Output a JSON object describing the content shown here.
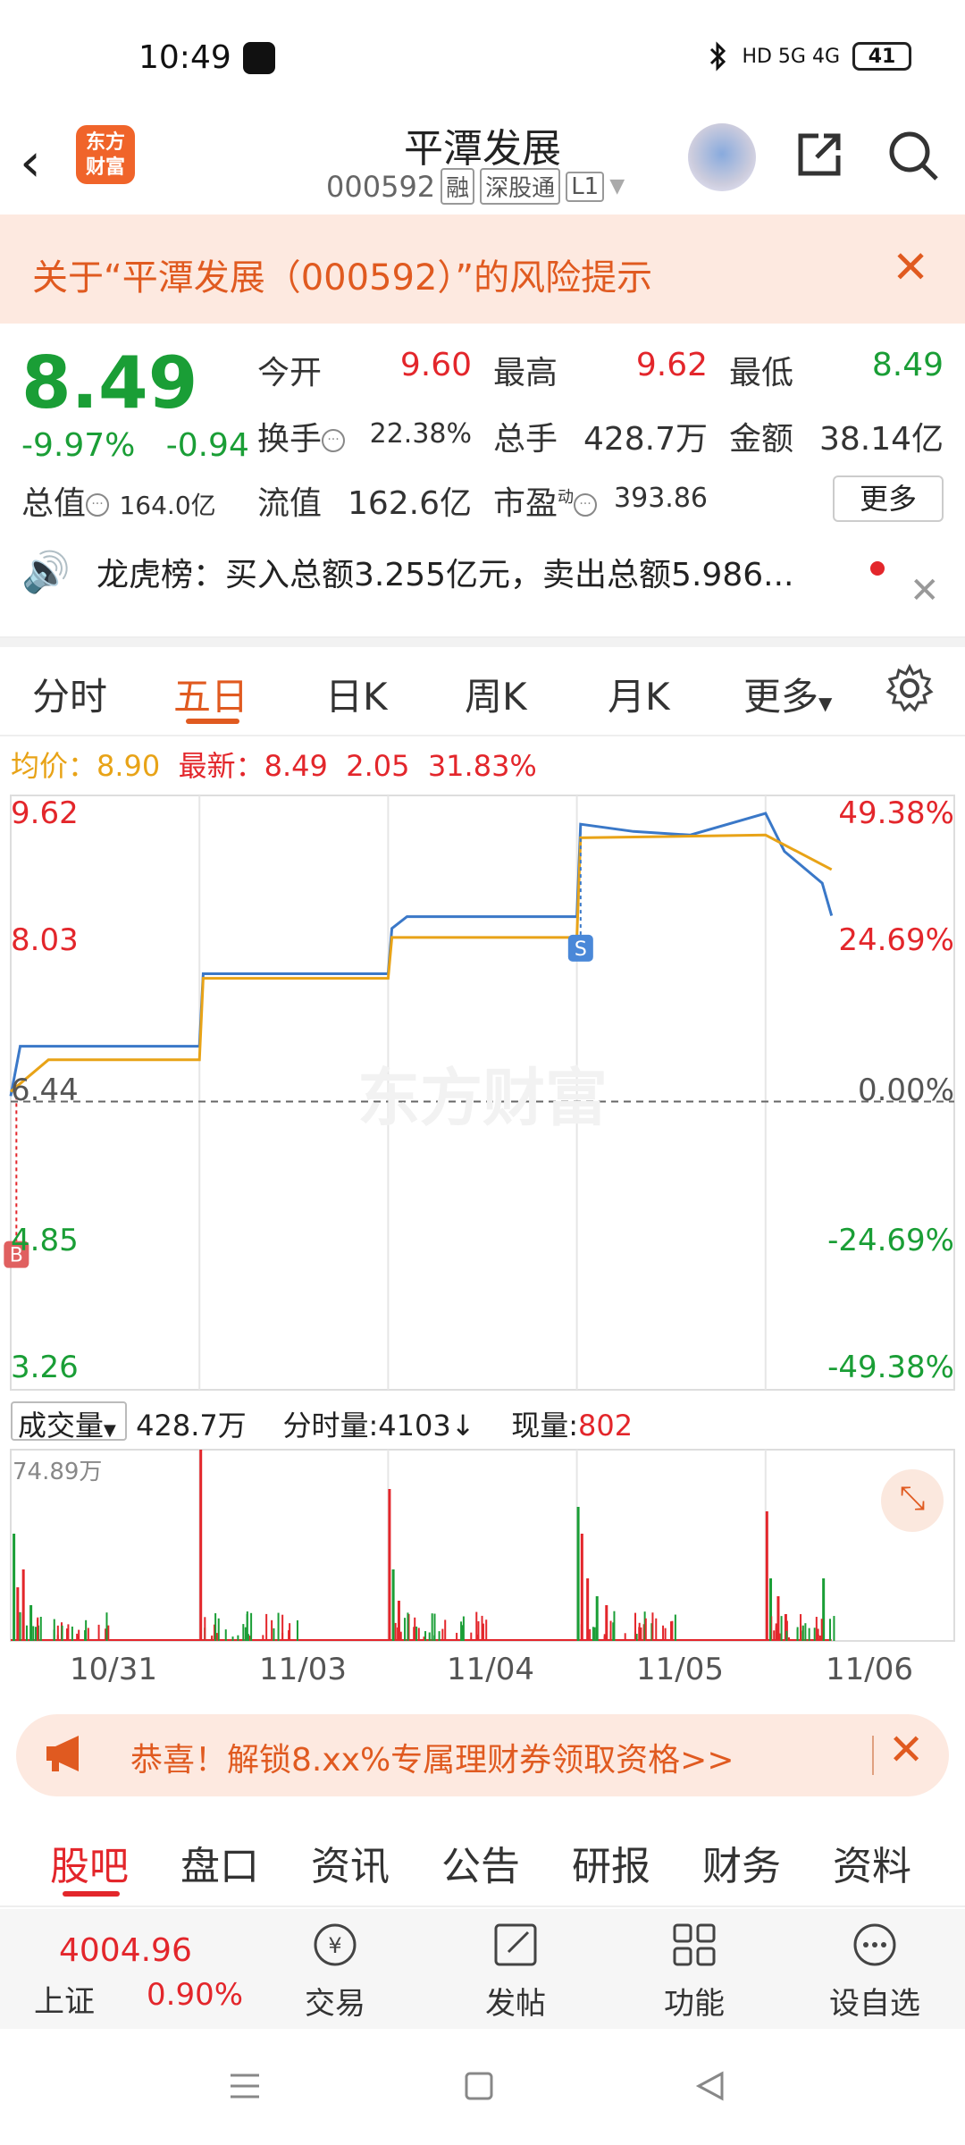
{
  "status_bar": {
    "time": "10:49",
    "network": "HD 5G 4G",
    "battery": "41"
  },
  "header": {
    "back": "‹",
    "logo_line1": "东方",
    "logo_line2": "财富",
    "stock_name": "平潭发展",
    "stock_code": "000592",
    "tag_margin": "融",
    "tag_connect": "深股通",
    "tag_level": "L1"
  },
  "risk_banner": {
    "text": "关于“平潭发展（000592）”的风险提示"
  },
  "quote": {
    "price": "8.49",
    "change_pct": "-9.97%",
    "change_amt": "-0.94",
    "open_label": "今开",
    "open": "9.60",
    "high_label": "最高",
    "high": "9.62",
    "low_label": "最低",
    "low": "8.49",
    "turnover_label": "换手",
    "turnover": "22.38%",
    "volume_label": "总手",
    "volume": "428.7万",
    "amount_label": "金额",
    "amount": "38.14亿",
    "mktcap_label": "总值",
    "mktcap": "164.0亿",
    "float_label": "流值",
    "float": "162.6亿",
    "pe_label": "市盈",
    "pe_sup": "动",
    "pe": "393.86",
    "more": "更多"
  },
  "dragon_tiger": {
    "text": "龙虎榜：买入总额3.255亿元，卖出总额5.986..."
  },
  "chart_tabs": [
    "分时",
    "五日",
    "日K",
    "周K",
    "月K",
    "更多"
  ],
  "avg_line": {
    "avg_label": "均价：",
    "avg": "8.90",
    "latest_label": "最新：",
    "latest": "8.49",
    "change": "2.05",
    "change_pct": "31.83%"
  },
  "chart_data": {
    "type": "line",
    "y_left_ticks": [
      "9.62",
      "8.03",
      "6.44",
      "4.85",
      "3.26"
    ],
    "y_right_ticks": [
      "49.38%",
      "24.69%",
      "0.00%",
      "-24.69%",
      "-49.38%"
    ],
    "x": [
      "10/31",
      "11/03",
      "11/04",
      "11/05",
      "11/06"
    ],
    "ylim": [
      3.26,
      9.62
    ],
    "series": [
      {
        "name": "price",
        "color": "#3a78c8",
        "values": [
          [
            0.0,
            6.5
          ],
          [
            0.05,
            7.05
          ],
          [
            0.2,
            7.05
          ],
          [
            1.0,
            7.05
          ],
          [
            1.02,
            7.85
          ],
          [
            2.0,
            7.85
          ],
          [
            2.02,
            8.35
          ],
          [
            2.1,
            8.48
          ],
          [
            3.0,
            8.48
          ],
          [
            3.02,
            9.5
          ],
          [
            3.3,
            9.42
          ],
          [
            3.6,
            9.38
          ],
          [
            4.0,
            9.62
          ],
          [
            4.1,
            9.2
          ],
          [
            4.3,
            8.85
          ],
          [
            4.35,
            8.49
          ]
        ]
      },
      {
        "name": "avg",
        "color": "#e8a317",
        "values": [
          [
            0.0,
            6.55
          ],
          [
            0.2,
            6.9
          ],
          [
            1.0,
            6.9
          ],
          [
            1.02,
            7.8
          ],
          [
            2.0,
            7.8
          ],
          [
            2.02,
            8.25
          ],
          [
            3.0,
            8.25
          ],
          [
            3.02,
            9.35
          ],
          [
            4.0,
            9.38
          ],
          [
            4.35,
            9.0
          ]
        ]
      }
    ],
    "markers": [
      {
        "label": "B",
        "at": "10/31"
      },
      {
        "label": "S",
        "at": "11/05"
      }
    ]
  },
  "volume": {
    "selector": "成交量",
    "total": "428.7万",
    "tick_label": "分时量:",
    "tick": "4103",
    "current_label": "现量:",
    "current": "802",
    "max": "74.89万"
  },
  "promo": {
    "text": "恭喜！解锁8.xx%专属理财券领取资格>>"
  },
  "bottom_tabs": [
    "股吧",
    "盘口",
    "资讯",
    "公告",
    "研报",
    "财务",
    "资料"
  ],
  "toolbar": {
    "index_value": "4004.96",
    "index_name": "上证",
    "index_change": "0.90%",
    "tools": [
      "交易",
      "发帖",
      "功能",
      "设自选"
    ]
  },
  "colors": {
    "up": "#e3262b",
    "down": "#1a9e36",
    "accent": "#e05a20",
    "price_line": "#3a78c8",
    "avg_line": "#e8a317"
  }
}
